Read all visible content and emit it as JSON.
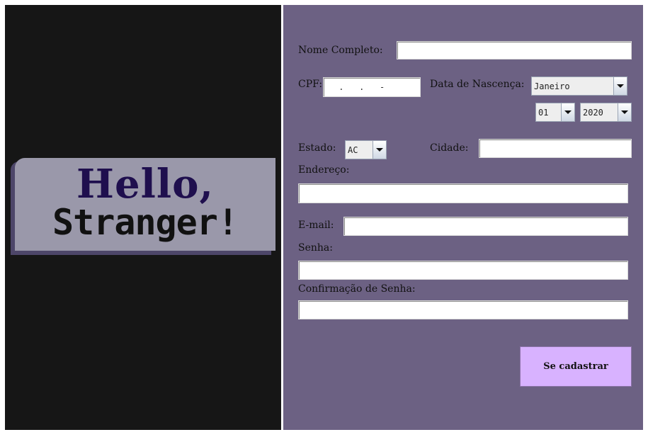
{
  "banner": {
    "line1": "Hello,",
    "line2": "Stranger!"
  },
  "form": {
    "nome_label": "Nome Completo:",
    "nome_value": "",
    "cpf_label": "CPF:",
    "cpf_value": " .   .   -",
    "data_label": "Data de Nascença:",
    "mes_value": "Janeiro",
    "dia_value": "01",
    "ano_value": "2020",
    "estado_label": "Estado:",
    "estado_value": "AC",
    "cidade_label": "Cidade:",
    "cidade_value": "",
    "endereco_label": "Endereço:",
    "endereco_value": "",
    "email_label": "E-mail:",
    "email_value": "",
    "senha_label": "Senha:",
    "senha_value": "",
    "confirmacao_label": "Confirmação de Senha:",
    "confirmacao_value": "",
    "submit_label": "Se cadastrar"
  },
  "colors": {
    "left_background": "#161616",
    "form_background": "#6c6183",
    "banner_background": "#9a98aa",
    "hello_text": "#1f0f4e",
    "submit_button": "#d8b2ff"
  }
}
